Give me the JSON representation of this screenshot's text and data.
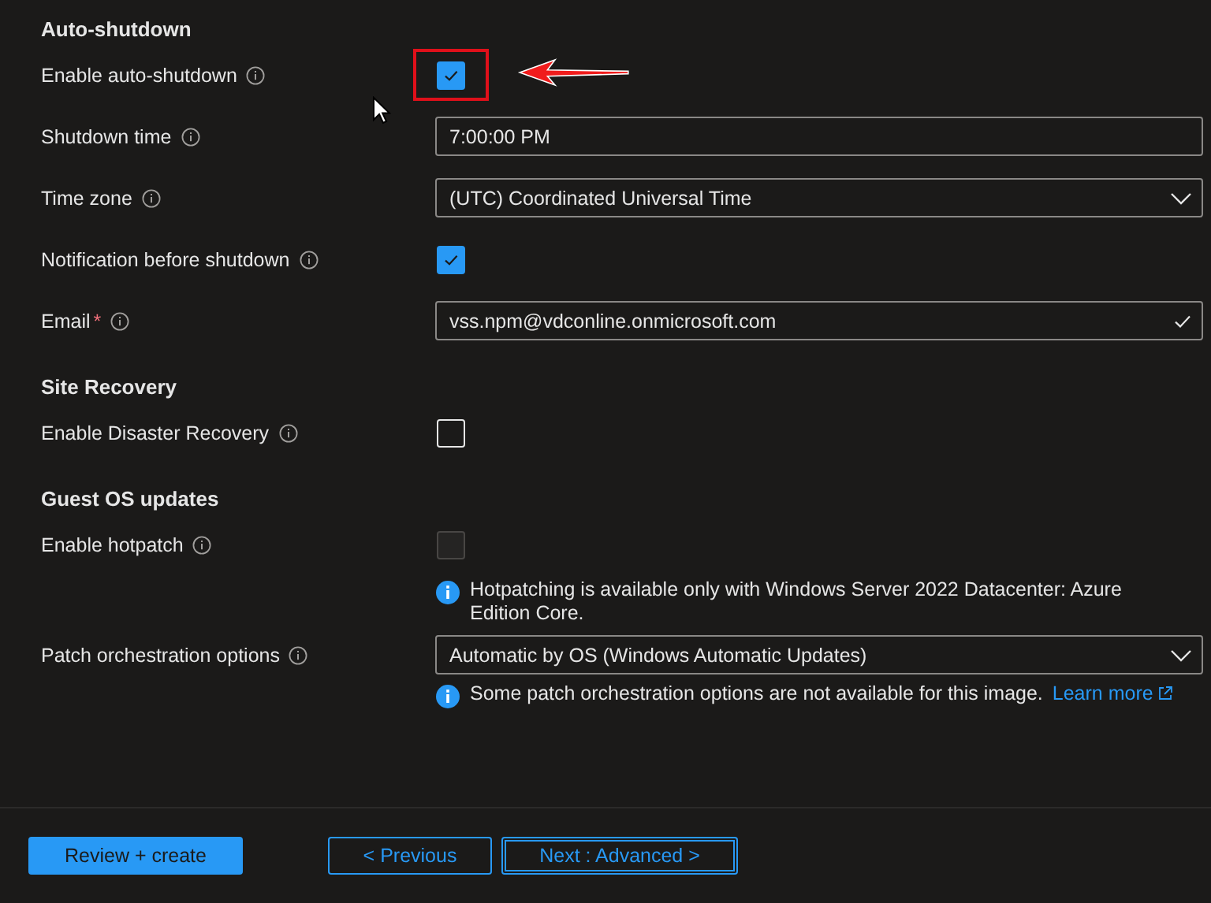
{
  "sections": [
    {
      "title": "Auto-shutdown",
      "rows": [
        {
          "label": "Enable auto-shutdown",
          "kind": "checkbox",
          "checked": true,
          "disabled": false,
          "highlighted": true
        },
        {
          "label": "Shutdown time",
          "kind": "text",
          "value": "7:00:00 PM"
        },
        {
          "label": "Time zone",
          "kind": "select",
          "value": "(UTC) Coordinated Universal Time"
        },
        {
          "label": "Notification before shutdown",
          "kind": "checkbox",
          "checked": true,
          "disabled": false
        },
        {
          "label": "Email",
          "required_mark": "*",
          "kind": "text",
          "value": "vss.npm@vdconline.onmicrosoft.com",
          "valid": true
        }
      ]
    },
    {
      "title": "Site Recovery",
      "rows": [
        {
          "label": "Enable Disaster Recovery",
          "kind": "checkbox",
          "checked": false,
          "disabled": false
        }
      ]
    },
    {
      "title": "Guest OS updates",
      "rows": [
        {
          "label": "Enable hotpatch",
          "kind": "checkbox",
          "checked": false,
          "disabled": true,
          "note": {
            "text": "Hotpatching is available only with Windows Server 2022 Datacenter: Azure Edition Core."
          }
        },
        {
          "label": "Patch orchestration options",
          "kind": "select",
          "value": "Automatic by OS (Windows Automatic Updates)",
          "note": {
            "text": "Some patch orchestration options are not available for this image.",
            "link": "Learn more"
          }
        }
      ]
    }
  ],
  "footer": {
    "buttons": [
      {
        "label": "Review + create",
        "kind": "primary"
      },
      {
        "label": "< Previous",
        "kind": "secondary"
      },
      {
        "label": "Next : Advanced >",
        "kind": "focused"
      }
    ]
  }
}
